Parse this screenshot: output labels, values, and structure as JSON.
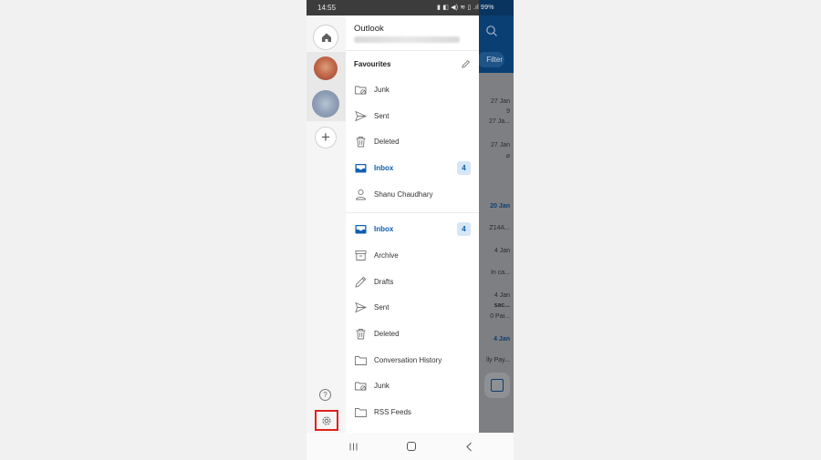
{
  "status_bar": {
    "time": "14:55",
    "icons_text": "▮ ◧ ◀) ≋ ▯ .ıl",
    "battery": "99%"
  },
  "rail": {
    "home_label": "Home",
    "add_label": "+",
    "help_label": "?"
  },
  "drawer": {
    "app_title": "Outlook",
    "favourites_label": "Favourites",
    "favourites": [
      {
        "label": "Junk",
        "icon": "junk-icon"
      },
      {
        "label": "Sent",
        "icon": "sent-icon"
      },
      {
        "label": "Deleted",
        "icon": "deleted-icon"
      },
      {
        "label": "Inbox",
        "icon": "inbox-icon",
        "badge": "4",
        "active": true
      },
      {
        "label": "Shanu Chaudhary",
        "icon": "person-icon"
      }
    ],
    "folders": [
      {
        "label": "Inbox",
        "icon": "inbox-icon",
        "badge": "4",
        "active": true
      },
      {
        "label": "Archive",
        "icon": "archive-icon"
      },
      {
        "label": "Drafts",
        "icon": "drafts-icon"
      },
      {
        "label": "Sent",
        "icon": "sent-icon"
      },
      {
        "label": "Deleted",
        "icon": "deleted-icon"
      },
      {
        "label": "Conversation History",
        "icon": "folder-icon"
      },
      {
        "label": "Junk",
        "icon": "junk-icon"
      },
      {
        "label": "RSS Feeds",
        "icon": "folder-icon"
      }
    ]
  },
  "background": {
    "filter_label": "Filter",
    "texts": [
      "27 Jan",
      "9",
      "27 Ja...",
      "27 Jan",
      "20 Jan",
      "Z14A...",
      "4 Jan",
      "In ca...",
      "4 Jan",
      "sac...",
      "0 Pai...",
      "4 Jan",
      "lly Pay..."
    ]
  },
  "colors": {
    "accent": "#0f5fb0",
    "header": "#0a3f73",
    "highlight": "#e0221d"
  }
}
